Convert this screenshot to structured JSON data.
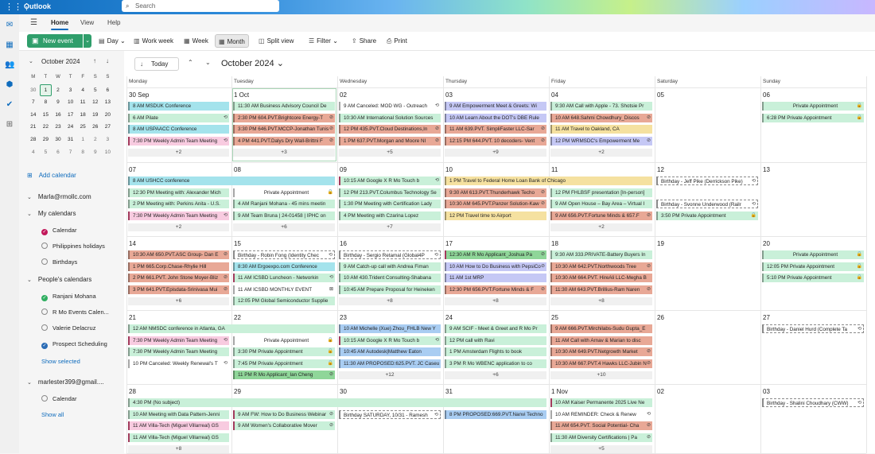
{
  "app": {
    "name": "Outlook",
    "search_placeholder": "Search",
    "waffle": "⋮⋮⋮"
  },
  "rail": [
    {
      "name": "mail-icon",
      "glyph": "✉"
    },
    {
      "name": "calendar-rail-icon",
      "glyph": "▦"
    },
    {
      "name": "people-icon",
      "glyph": "👥"
    },
    {
      "name": "groups-icon",
      "glyph": "⬢"
    },
    {
      "name": "todo-icon",
      "glyph": "✔"
    },
    {
      "name": "apps-icon",
      "glyph": "⊞"
    }
  ],
  "ribbon": {
    "tabs": [
      "Home",
      "View",
      "Help"
    ]
  },
  "toolbar": {
    "new_event": "New event",
    "day": "Day",
    "work_week": "Work week",
    "week": "Week",
    "month": "Month",
    "split_view": "Split view",
    "filter": "Filter",
    "share": "Share",
    "print": "Print"
  },
  "mini_calendar": {
    "title": "October 2024",
    "weekdays": [
      "M",
      "T",
      "W",
      "T",
      "F",
      "S",
      "S"
    ],
    "weeks": [
      [
        "30",
        "1",
        "2",
        "3",
        "4",
        "5",
        "6"
      ],
      [
        "7",
        "8",
        "9",
        "10",
        "11",
        "12",
        "13"
      ],
      [
        "14",
        "15",
        "16",
        "17",
        "18",
        "19",
        "20"
      ],
      [
        "21",
        "22",
        "23",
        "24",
        "25",
        "26",
        "27"
      ],
      [
        "28",
        "29",
        "30",
        "31",
        "1",
        "2",
        "3"
      ],
      [
        "4",
        "5",
        "6",
        "7",
        "8",
        "9",
        "10"
      ]
    ],
    "today": "1"
  },
  "left_panel": {
    "add_calendar": "Add calendar",
    "account1": "Marla@rmollc.com",
    "my_calendars": "My calendars",
    "my_items": [
      {
        "label": "Calendar",
        "color": "#c2185b",
        "checked": true
      },
      {
        "label": "Philippines holidays",
        "color": "",
        "checked": false
      },
      {
        "label": "Birthdays",
        "color": "",
        "checked": false
      }
    ],
    "peoples_calendars": "People's calendars",
    "people_items": [
      {
        "label": "Ranjani Mohana",
        "color": "#2fae60",
        "checked": true
      },
      {
        "label": "R Mo Events Calen...",
        "color": "",
        "checked": false
      },
      {
        "label": "Valerie Delacruz",
        "color": "",
        "checked": false
      },
      {
        "label": "Prospect Scheduling",
        "color": "#2b6cb5",
        "checked": true
      }
    ],
    "show_selected": "Show selected",
    "account2": "marlester399@gmail....",
    "account2_items": [
      {
        "label": "Calendar",
        "color": "",
        "checked": false
      }
    ],
    "show_all": "Show all"
  },
  "calendar": {
    "today_label": "Today",
    "month_title": "October 2024",
    "weekdays": [
      "Monday",
      "Tuesday",
      "Wednesday",
      "Thursday",
      "Friday",
      "Saturday",
      "Sunday"
    ],
    "weeks": [
      {
        "days": [
          "30 Sep",
          "1 Oct",
          "02",
          "03",
          "04",
          "05",
          "06"
        ],
        "more": [
          "+2",
          "+3",
          "+5",
          "+9",
          "+2",
          "",
          ""
        ],
        "events": [
          [
            {
              "t": "8 AM MSDUK Conference",
              "c": "cyan"
            },
            {
              "t": "6 AM Pilate",
              "c": "mint",
              "i": "⟲"
            },
            {
              "t": "8 AM USPAACC Conference",
              "c": "cyan"
            },
            {
              "t": "7:30 PM Weekly Admin Team Meeting",
              "c": "pink",
              "i": "⟲",
              "h": 1
            }
          ],
          [
            {
              "t": "11:30 AM Business Advisory Council De",
              "c": "mint"
            },
            {
              "t": "2:30 PM 604.PVT.Brightcore Energy-T",
              "c": "salmon",
              "i": "⊘"
            },
            {
              "t": "3:30 PM 646.PVT.MCCP-Jonathan Tunis",
              "c": "salmon",
              "i": "⊘"
            },
            {
              "t": "4 PM 441.PVT.Dalys Dry Wall-Brittni F",
              "c": "salmon",
              "i": "⊘"
            }
          ],
          [
            {
              "t": "9 AM Canceled: MOD WG - Outreach",
              "c": "white",
              "i": "⟲"
            },
            {
              "t": "10:30 AM International Solution Sources",
              "c": "mint"
            },
            {
              "t": "12 PM 435.PVT.Cloud Destinations,In",
              "c": "salmon",
              "i": "⊘"
            },
            {
              "t": "1 PM 637.PVT.Morgan and Moore NI",
              "c": "salmon",
              "i": "⊘"
            }
          ],
          [
            {
              "t": "9 AM Empowerment Meet & Greets: Wi",
              "c": "lav"
            },
            {
              "t": "10 AM Learn About the DOT's DBE Rule",
              "c": "lav"
            },
            {
              "t": "11 AM 639.PVT. SimpliFaster LLC-Sar",
              "c": "salmon",
              "i": "⊘"
            },
            {
              "t": "12:15 PM 644.PVT. 10 decoders- Vent",
              "c": "salmon",
              "i": "⊘"
            }
          ],
          [
            {
              "t": "9:30 AM Call with Apple - 73. Shotsie Pr",
              "c": "mint"
            },
            {
              "t": "10 AM 648.Sahmi Chowdhury_Discos",
              "c": "salmon",
              "i": "⊘"
            },
            {
              "t": "11 AM Travel to Oakland, CA",
              "c": "yellow"
            },
            {
              "t": "12 PM WRMSDC's Empowerment Me",
              "c": "lav",
              "i": "⊘"
            }
          ],
          [],
          [
            {
              "t": "Private Appointment",
              "c": "mint",
              "i": "🔒",
              "ctr": 1
            },
            {
              "t": "6:28 PM Private Appointment",
              "c": "mint",
              "i": "🔒"
            }
          ]
        ]
      },
      {
        "days": [
          "07",
          "08",
          "09",
          "10",
          "11",
          "12",
          "13"
        ],
        "more": [
          "+2",
          "+6",
          "+7",
          "",
          "+2",
          "",
          ""
        ],
        "events": [
          [
            {
              "t": "8 AM USHCC conference",
              "c": "cyan",
              "span": 2
            },
            {
              "t": "12:30 PM Meeting with: Alexander Mich",
              "c": "mint"
            },
            {
              "t": "2 PM Meeting with: Perkins Anita - U.S.",
              "c": "mint"
            },
            {
              "t": "7:30 PM Weekly Admin Team Meeting",
              "c": "pink",
              "i": "⟲",
              "h": 1
            }
          ],
          [
            {
              "t": "",
              "c": "none"
            },
            {
              "t": "Private Appointment",
              "c": "white",
              "i": "🔒",
              "ctr": 1
            },
            {
              "t": "4 AM Ranjani Mohana - 45 mins meetin",
              "c": "mint"
            },
            {
              "t": "9 AM Team Bruna | 24-01458 | IPHC on",
              "c": "mint"
            }
          ],
          [
            {
              "t": "10:15 AM Google X R Mo Touch b",
              "c": "mint",
              "i": "⟲",
              "h": 1
            },
            {
              "t": "12 PM 213.PVT.Columbus Technology Se",
              "c": "mint"
            },
            {
              "t": "1:30 PM Meeting with Certification Lady",
              "c": "mint"
            },
            {
              "t": "4 PM Meeting with Czarina Lopez",
              "c": "mint"
            }
          ],
          [
            {
              "t": "1 PM Travel to Federal Home Loan Bank of Chicago",
              "c": "yellow",
              "span": 2
            },
            {
              "t": "9:30 AM 613.PVT.Thunderhawk Techo",
              "c": "salmon",
              "i": "⊘"
            },
            {
              "t": "10:30 AM 645.PVT.Panzer Solution-Kaw",
              "c": "salmon",
              "i": "⊘"
            },
            {
              "t": "12 PM Travel time to Airport",
              "c": "yellow"
            }
          ],
          [
            {
              "t": "",
              "c": "none"
            },
            {
              "t": "12 PM FHLBSF presentation [In-person]",
              "c": "mint"
            },
            {
              "t": "9 AM Open House – Bay Area – Virtual I",
              "c": "mint"
            },
            {
              "t": "9 AM 656.PVT.Fortune Minds & 657.F",
              "c": "salmon",
              "i": "⊘"
            }
          ],
          [
            {
              "t": "Birthday - Jeff Pike (Derrickson Pike)",
              "c": "outline",
              "i": "⟲"
            },
            {
              "t": "",
              "c": "none"
            },
            {
              "t": "Birthday - Svonne Underwood (Railr",
              "c": "outline",
              "i": "⟲"
            },
            {
              "t": "3:50 PM Private Appointment",
              "c": "mint",
              "i": "🔒"
            }
          ],
          []
        ]
      },
      {
        "days": [
          "14",
          "15",
          "16",
          "17",
          "18",
          "19",
          "20"
        ],
        "more": [
          "+6",
          "",
          "+8",
          "+8",
          "+8",
          "",
          ""
        ],
        "events": [
          [
            {
              "t": "10:30 AM 650.PVT.ASC Group- Dan E",
              "c": "salmon",
              "i": "⊘"
            },
            {
              "t": "1 PM 665.Corp.Chase-Rhylie Hill",
              "c": "salmon"
            },
            {
              "t": "2 PM 661.PVT. John Stone Moyer-Bliz",
              "c": "salmon",
              "i": "⊘"
            },
            {
              "t": "3 PM 641.PVT.Episdata-Srinivasa Mui",
              "c": "salmon",
              "i": "⊘"
            }
          ],
          [
            {
              "t": "Birthday - Robin Fong (Identity Chec",
              "c": "outline",
              "i": "⟲"
            },
            {
              "t": "8:30 AM Ergoexpo.com Conference",
              "c": "cyan"
            },
            {
              "t": "11 AM ICSBD Luncheon - Networkin",
              "c": "mint",
              "i": "⟲",
              "h": 1
            },
            {
              "t": "11 AM ICSBD MONTHLY EVENT",
              "c": "white",
              "i": "⊠"
            },
            {
              "t": "12:05 PM Global Semiconductor Supplie",
              "c": "mint"
            }
          ],
          [
            {
              "t": "Birthday - Sergio Retamal (Global4P",
              "c": "outline",
              "i": "⟲"
            },
            {
              "t": "9 AM Catch-up call with Andrea Fiman",
              "c": "mint"
            },
            {
              "t": "10 AM 430.Trident Consulting-Shabana",
              "c": "mint"
            },
            {
              "t": "10:45 AM Prepare Proposal for Heineken",
              "c": "mint"
            }
          ],
          [
            {
              "t": "12:30 AM R Mo Applicant_Joshua Pa",
              "c": "green",
              "i": "⊘",
              "h": 1
            },
            {
              "t": "10 AM How to Do Business with PepsiCo",
              "c": "lav",
              "i": "⊘"
            },
            {
              "t": "11 AM 1st MRP",
              "c": "lav"
            },
            {
              "t": "12:30 PM 656.PVT.Fortune Minds & F",
              "c": "salmon",
              "i": "⊘"
            }
          ],
          [
            {
              "t": "9:30 AM 333.PRIVATE-Battery Buyers In",
              "c": "mint"
            },
            {
              "t": "10:30 AM 642.PVT.Northwoods Tree",
              "c": "salmon",
              "i": "⊘"
            },
            {
              "t": "10:30 AM 664.PVT. HireAli LLC-Megha B",
              "c": "salmon"
            },
            {
              "t": "11:30 AM 643.PVT.Brillius-Ram Naren",
              "c": "salmon",
              "i": "⊘"
            }
          ],
          [],
          [
            {
              "t": "Private Appointment",
              "c": "mint",
              "i": "🔒",
              "ctr": 1
            },
            {
              "t": "12:05 PM Private Appointment",
              "c": "mint",
              "i": "🔒"
            },
            {
              "t": "5:10 PM Private Appointment",
              "c": "mint",
              "i": "🔒"
            }
          ]
        ]
      },
      {
        "days": [
          "21",
          "22",
          "23",
          "24",
          "25",
          "26",
          "27"
        ],
        "more": [
          "",
          "",
          "+12",
          "+6",
          "+10",
          "",
          ""
        ],
        "events": [
          [
            {
              "t": "12 AM NMSDC conference in Atlanta, GA",
              "c": "mint",
              "span": 2
            },
            {
              "t": "7:30 PM Weekly Admin Team Meeting",
              "c": "pink",
              "i": "⟲",
              "h": 1
            },
            {
              "t": "7:30 PM Weekly Admin Team Meeting",
              "c": "mint"
            },
            {
              "t": "10 PM Canceled: Weekly Renewal's T",
              "c": "white",
              "i": "⟲"
            }
          ],
          [
            {
              "t": "",
              "c": "none"
            },
            {
              "t": "Private Appointment",
              "c": "white",
              "i": "🔒",
              "ctr": 1
            },
            {
              "t": "3:30 PM Private Appointment",
              "c": "mint",
              "i": "🔒"
            },
            {
              "t": "7:45 PM Private Appointment",
              "c": "mint",
              "i": "🔒"
            },
            {
              "t": "11 PM R Mo Applicant_Ian Cheng",
              "c": "green",
              "i": "⊘"
            }
          ],
          [
            {
              "t": "10 AM Michelle (Xue) Zhou_FHLB New Y",
              "c": "blue"
            },
            {
              "t": "10:15 AM Google X R Mo Touch b",
              "c": "mint",
              "i": "⟲",
              "h": 1
            },
            {
              "t": "10:45 AM Autodesk|Matthew Eaton",
              "c": "blue"
            },
            {
              "t": "11:30 AM PROPOSED:625.PVT. JC Caseu",
              "c": "blue"
            }
          ],
          [
            {
              "t": "9 AM SCIF - Meet & Greet and R Mo Pr",
              "c": "mint"
            },
            {
              "t": "12 PM call with Ravi",
              "c": "mint"
            },
            {
              "t": "1 PM Amsterdam Flights to book",
              "c": "mint"
            },
            {
              "t": "3 PM R Mo WBENC application to co",
              "c": "mint"
            }
          ],
          [
            {
              "t": "9 AM 666.PVT.Mirchilabs-Sudu Gupta_E",
              "c": "salmon"
            },
            {
              "t": "11 AM Call with Arnav & Marian to disc",
              "c": "salmon"
            },
            {
              "t": "10:30 AM 649.PVT.Netgrowth Market",
              "c": "salmon",
              "i": "⊘"
            },
            {
              "t": "10:30 AM 667.PVT.4 Hawks LLC-Jubin N",
              "c": "salmon",
              "i": "⊘"
            }
          ],
          [],
          [
            {
              "t": "Birthday - Daniel Hurd (Complete Ta",
              "c": "outline",
              "i": "⟲"
            }
          ]
        ]
      },
      {
        "days": [
          "28",
          "29",
          "30",
          "31",
          "1 Nov",
          "02",
          "03"
        ],
        "more": [
          "+8",
          "",
          "",
          "",
          "+5",
          "",
          ""
        ],
        "events": [
          [
            {
              "t": "4:30 PM (No subject)",
              "c": "mint",
              "span": 4
            },
            {
              "t": "10 AM Meeting with Data Pattern-Jenni",
              "c": "mint"
            },
            {
              "t": "11 AM Villa-Tech (Miguel Villarreal) GS",
              "c": "pink",
              "h": 1
            },
            {
              "t": "11 AM Villa-Tech (Miguel Villarreal) GS",
              "c": "mint",
              "h": 1
            }
          ],
          [
            {
              "t": "",
              "c": "none"
            },
            {
              "t": "9 AM FW: How to Do Business Webinar",
              "c": "mint",
              "i": "⊘",
              "h": 1
            },
            {
              "t": "9 AM Women's Collaborative Mover",
              "c": "mint",
              "i": "⊘",
              "h": 1
            }
          ],
          [
            {
              "t": "",
              "c": "none"
            },
            {
              "t": "Birthday SATURDAY, 10/31 - Ramesh",
              "c": "outline",
              "i": "⟲"
            }
          ],
          [
            {
              "t": "",
              "c": "none"
            },
            {
              "t": "8 PM PROPOSED:669.PVT.Nanvi Techno",
              "c": "blue"
            }
          ],
          [
            {
              "t": "10 AM Kaiser Permanente 2025 Live Ne",
              "c": "mint",
              "h": 1
            },
            {
              "t": "10 AM REMINDER: Check & Renew",
              "c": "white",
              "i": "⟲"
            },
            {
              "t": "11 AM 654.PVT. Social Potential- Cha",
              "c": "salmon",
              "i": "⊘"
            },
            {
              "t": "11:30 AM Diversity Certifications | Pa",
              "c": "mint",
              "i": "⊘"
            }
          ],
          [],
          [
            {
              "t": "Birthday - Shalini Choudhary (CWW)",
              "c": "outline",
              "i": "⟲"
            }
          ]
        ]
      }
    ]
  },
  "colors": {
    "cyan": "#a4e3ec",
    "mint": "#c9f0d9",
    "salmon": "#e8a896",
    "lav": "#c5c8f5",
    "yellow": "#f5e1a0",
    "pink": "#f8cbe0",
    "blue": "#a9cdf2",
    "green": "#8fd699",
    "white": "#ffffff",
    "outline": "#ffffff"
  }
}
